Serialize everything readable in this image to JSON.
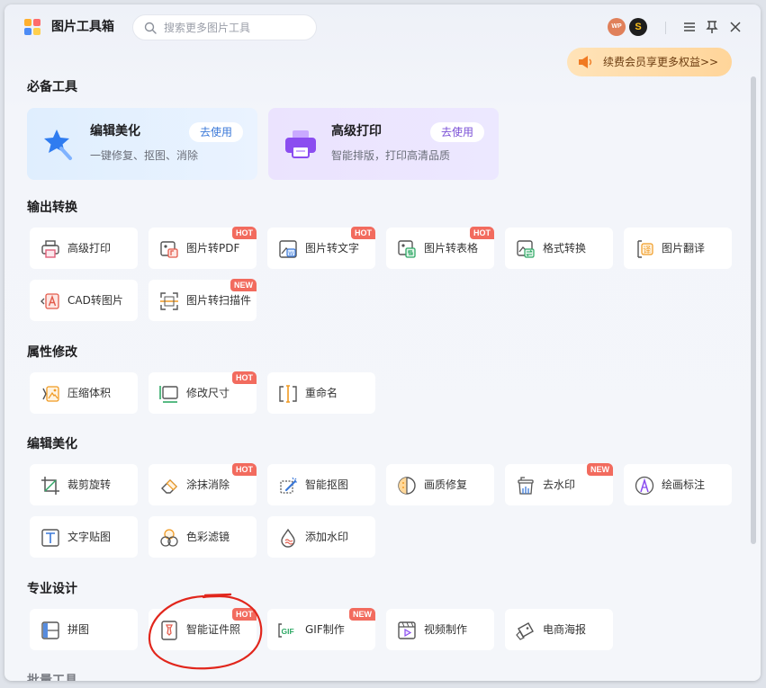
{
  "app": {
    "title": "图片工具箱"
  },
  "search": {
    "placeholder": "搜索更多图片工具",
    "value": ""
  },
  "header": {
    "wp_badge": "WP",
    "coin_badge": "S",
    "vip_text": "续费会员享更多权益>>"
  },
  "sections": {
    "essential": "必备工具",
    "output": "输出转换",
    "attr": "属性修改",
    "edit": "编辑美化",
    "design": "专业设计",
    "batch": "批量工具"
  },
  "featured": [
    {
      "title": "编辑美化",
      "desc": "一键修复、抠图、消除",
      "button": "去使用"
    },
    {
      "title": "高级打印",
      "desc": "智能排版，打印高清品质",
      "button": "去使用"
    }
  ],
  "tools": {
    "output": [
      {
        "label": "高级打印",
        "icon": "printer-icon",
        "badge": ""
      },
      {
        "label": "图片转PDF",
        "icon": "pdf-icon",
        "badge": "HOT"
      },
      {
        "label": "图片转文字",
        "icon": "image-text-icon",
        "badge": "HOT"
      },
      {
        "label": "图片转表格",
        "icon": "table-icon",
        "badge": "HOT"
      },
      {
        "label": "格式转换",
        "icon": "format-convert-icon",
        "badge": ""
      },
      {
        "label": "图片翻译",
        "icon": "translate-icon",
        "badge": ""
      },
      {
        "label": "CAD转图片",
        "icon": "cad-icon",
        "badge": ""
      },
      {
        "label": "图片转扫描件",
        "icon": "scan-icon",
        "badge": "NEW"
      }
    ],
    "attr": [
      {
        "label": "压缩体积",
        "icon": "compress-icon",
        "badge": ""
      },
      {
        "label": "修改尺寸",
        "icon": "resize-icon",
        "badge": "HOT"
      },
      {
        "label": "重命名",
        "icon": "rename-icon",
        "badge": ""
      }
    ],
    "edit": [
      {
        "label": "裁剪旋转",
        "icon": "crop-icon",
        "badge": ""
      },
      {
        "label": "涂抹消除",
        "icon": "eraser-icon",
        "badge": "HOT"
      },
      {
        "label": "智能抠图",
        "icon": "cutout-icon",
        "badge": ""
      },
      {
        "label": "画质修复",
        "icon": "quality-icon",
        "badge": ""
      },
      {
        "label": "去水印",
        "icon": "remove-watermark-icon",
        "badge": "NEW"
      },
      {
        "label": "绘画标注",
        "icon": "annotate-icon",
        "badge": ""
      },
      {
        "label": "文字贴图",
        "icon": "text-sticker-icon",
        "badge": ""
      },
      {
        "label": "色彩滤镜",
        "icon": "color-filter-icon",
        "badge": ""
      },
      {
        "label": "添加水印",
        "icon": "add-watermark-icon",
        "badge": ""
      }
    ],
    "design": [
      {
        "label": "拼图",
        "icon": "collage-icon",
        "badge": ""
      },
      {
        "label": "智能证件照",
        "icon": "id-photo-icon",
        "badge": "HOT"
      },
      {
        "label": "GIF制作",
        "icon": "gif-icon",
        "badge": "NEW"
      },
      {
        "label": "视频制作",
        "icon": "video-icon",
        "badge": ""
      },
      {
        "label": "电商海报",
        "icon": "poster-icon",
        "badge": ""
      }
    ]
  },
  "colors": {
    "hot_badge": "#f26b5e",
    "accent_blue": "#3a78d8",
    "accent_purple": "#7a4fd6",
    "annotation": "#e1261c"
  }
}
